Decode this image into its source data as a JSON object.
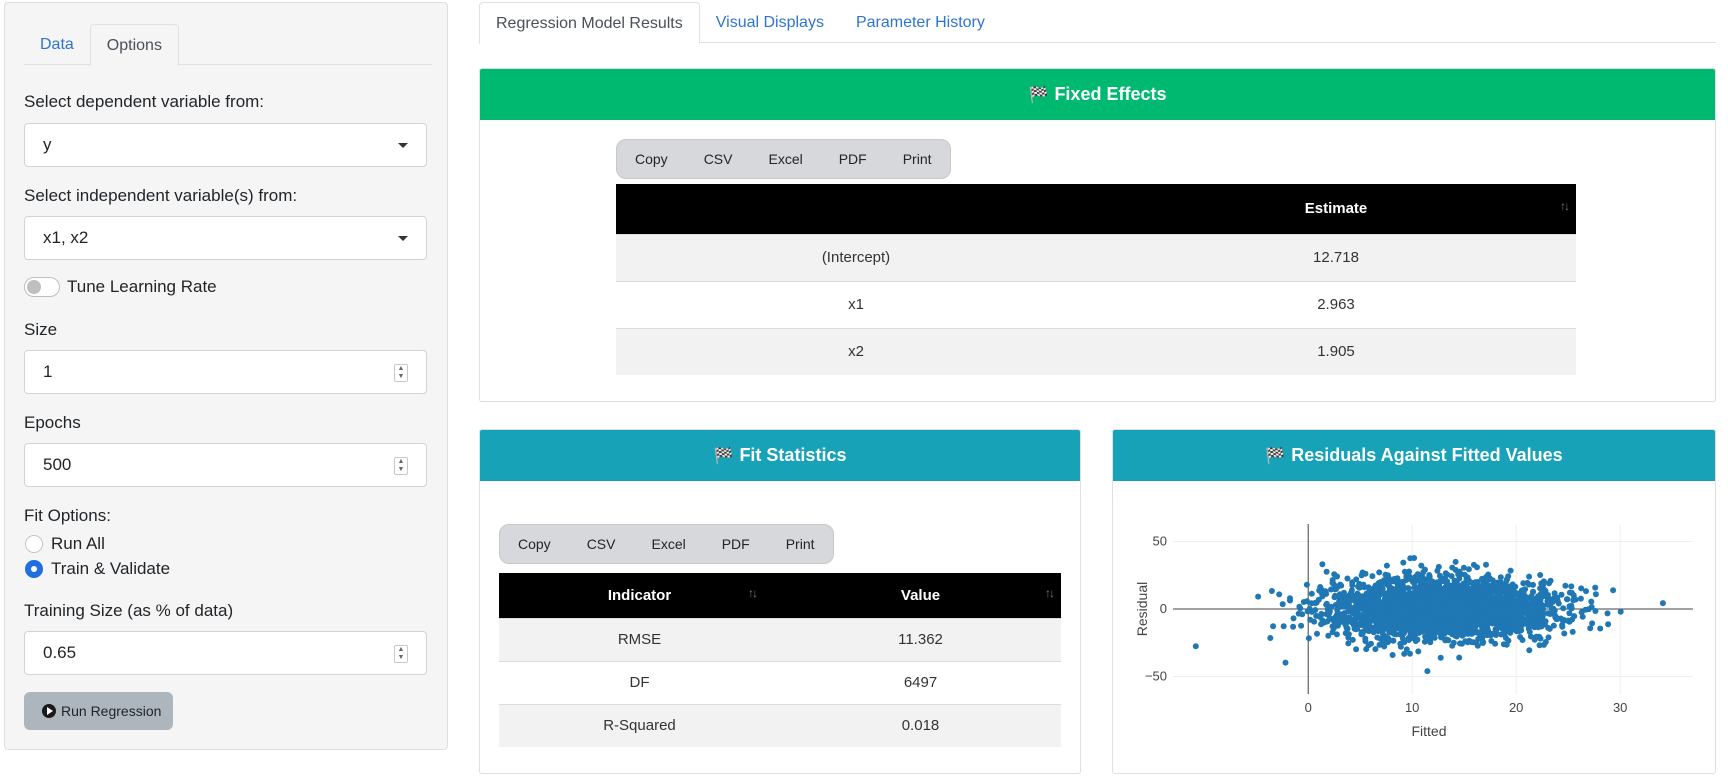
{
  "sidebar": {
    "tabs": [
      {
        "label": "Data"
      },
      {
        "label": "Options"
      }
    ],
    "dependent_label": "Select dependent variable from:",
    "dependent_value": "y",
    "independent_label": "Select independent variable(s) from:",
    "independent_value": "x1, x2",
    "tune_label": "Tune Learning Rate",
    "size_label": "Size",
    "size_value": "1",
    "epochs_label": "Epochs",
    "epochs_value": "500",
    "fit_options_label": "Fit Options:",
    "fit_options": [
      {
        "label": "Run All",
        "checked": false
      },
      {
        "label": "Train & Validate",
        "checked": true
      }
    ],
    "training_size_label": "Training Size (as % of data)",
    "training_size_value": "0.65",
    "run_button": "Run Regression"
  },
  "main_tabs": [
    {
      "label": "Regression Model Results"
    },
    {
      "label": "Visual Displays"
    },
    {
      "label": "Parameter History"
    }
  ],
  "export_buttons": [
    "Copy",
    "CSV",
    "Excel",
    "PDF",
    "Print"
  ],
  "fixed_effects": {
    "title": "Fixed Effects",
    "header_color": "#00b971",
    "columns": [
      "",
      "Estimate"
    ],
    "rows": [
      [
        "(Intercept)",
        "12.718"
      ],
      [
        "x1",
        "2.963"
      ],
      [
        "x2",
        "1.905"
      ]
    ]
  },
  "fit_statistics": {
    "title": "Fit Statistics",
    "header_color": "#17a2b8",
    "columns": [
      "Indicator",
      "Value"
    ],
    "rows": [
      [
        "RMSE",
        "11.362"
      ],
      [
        "DF",
        "6497"
      ],
      [
        "R-Squared",
        "0.018"
      ]
    ]
  },
  "residuals": {
    "title": "Residuals Against Fitted Values",
    "header_color": "#17a2b8"
  },
  "chart_data": {
    "type": "scatter",
    "title": "",
    "xlabel": "Fitted",
    "ylabel": "Residual",
    "xlim": [
      -13,
      37
    ],
    "ylim": [
      -63,
      63
    ],
    "x_ticks": [
      0,
      10,
      20,
      30
    ],
    "y_ticks": [
      50,
      0,
      -50
    ],
    "marker_color": "#1f77b4",
    "series": [
      {
        "n_points": 6500,
        "x_mean": 12.7,
        "x_sd": 5.5,
        "y_mean": 0,
        "y_sd": 11.36
      }
    ]
  }
}
